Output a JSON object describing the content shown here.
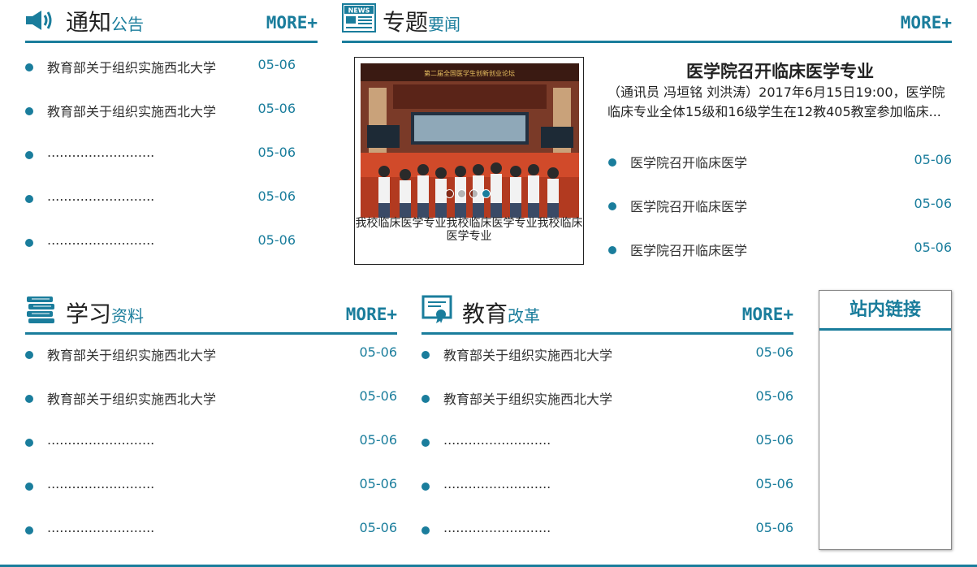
{
  "notice": {
    "title_big": "通知",
    "title_small": "公告",
    "more": "MORE+",
    "items": [
      {
        "text": "教育部关于组织实施西北大学",
        "date": "05-06"
      },
      {
        "text": "教育部关于组织实施西北大学",
        "date": "05-06"
      },
      {
        "text": "..........................",
        "date": "05-06"
      },
      {
        "text": "..........................",
        "date": "05-06"
      },
      {
        "text": "..........................",
        "date": "05-06"
      }
    ]
  },
  "topic": {
    "title_big": "专题",
    "title_small": "要闻",
    "more": "MORE+",
    "icon_label": "NEWS",
    "photo_banner": "第二届全国医学生创新创业论坛",
    "caption": "我校临床医学专业我校临床医学专业我校临床医学专业",
    "headline": "医学院召开临床医学专业",
    "summary": "（通讯员 冯垣铭 刘洪涛）2017年6月15日19:00，医学院临床专业全体15级和16级学生在12教405教室参加临床...",
    "items": [
      {
        "text": "医学院召开临床医学",
        "date": "05-06"
      },
      {
        "text": "医学院召开临床医学",
        "date": "05-06"
      },
      {
        "text": "医学院召开临床医学",
        "date": "05-06"
      }
    ]
  },
  "study": {
    "title_big": "学习",
    "title_small": "资料",
    "more": "MORE+",
    "items": [
      {
        "text": "教育部关于组织实施西北大学",
        "date": "05-06"
      },
      {
        "text": "教育部关于组织实施西北大学",
        "date": "05-06"
      },
      {
        "text": "..........................",
        "date": "05-06"
      },
      {
        "text": "..........................",
        "date": "05-06"
      },
      {
        "text": "..........................",
        "date": "05-06"
      }
    ]
  },
  "reform": {
    "title_big": "教育",
    "title_small": "改革",
    "more": "MORE+",
    "items": [
      {
        "text": "教育部关于组织实施西北大学",
        "date": "05-06"
      },
      {
        "text": "教育部关于组织实施西北大学",
        "date": "05-06"
      },
      {
        "text": "..........................",
        "date": "05-06"
      },
      {
        "text": "..........................",
        "date": "05-06"
      },
      {
        "text": "..........................",
        "date": "05-06"
      }
    ]
  },
  "links": {
    "title": "站内链接"
  },
  "colors": {
    "accent": "#1a7d9c"
  }
}
